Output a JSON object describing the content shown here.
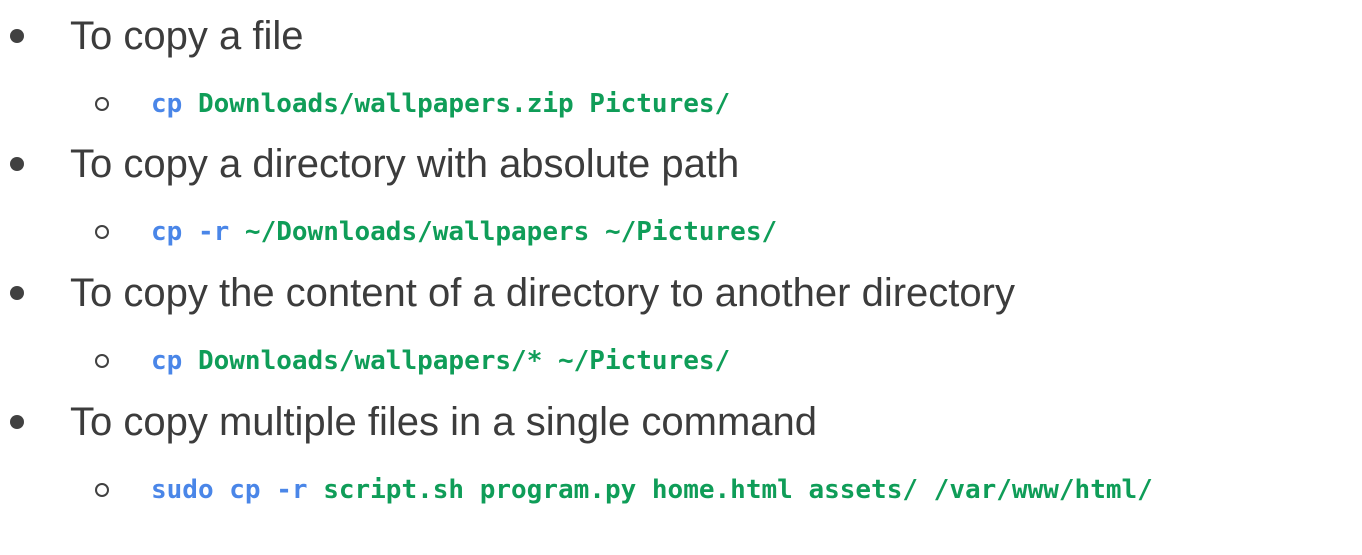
{
  "items": [
    {
      "text": "To copy a file",
      "command": {
        "cmd": "cp ",
        "args": "Downloads/wallpapers.zip Pictures/"
      }
    },
    {
      "text": "To copy a directory with absolute path",
      "command": {
        "cmd": "cp -r ",
        "args": "~/Downloads/wallpapers ~/Pictures/"
      }
    },
    {
      "text": "To copy the content of a directory to another directory",
      "command": {
        "cmd": "cp ",
        "args": "Downloads/wallpapers/* ~/Pictures/"
      }
    },
    {
      "text": "To copy multiple files in a single command",
      "command": {
        "cmd": "sudo cp -r ",
        "args": "script.sh program.py home.html assets/ /var/www/html/"
      }
    }
  ],
  "colors": {
    "command": "#4a86e8",
    "argument": "#0f9d58",
    "text": "#3c3c3c"
  }
}
